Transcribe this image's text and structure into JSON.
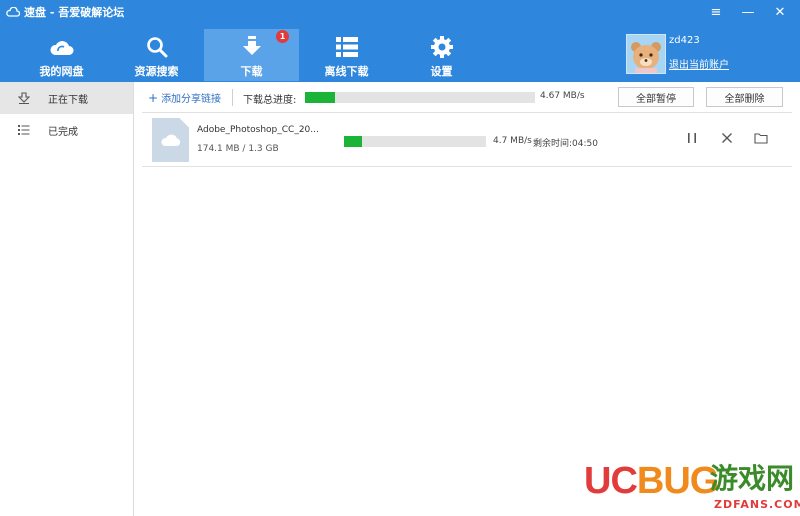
{
  "window": {
    "title": "速盘 - 吾爱破解论坛",
    "controls": [
      "≡",
      "—",
      "✕"
    ]
  },
  "nav": {
    "items": [
      {
        "label": "我的网盘",
        "icon": "cloud-icon"
      },
      {
        "label": "资源搜索",
        "icon": "search-icon"
      },
      {
        "label": "下载",
        "icon": "download-arrow-icon",
        "badge": "1",
        "active": true
      },
      {
        "label": "离线下载",
        "icon": "list-icon"
      },
      {
        "label": "设置",
        "icon": "gear-icon"
      }
    ]
  },
  "user": {
    "name": "zd423",
    "switch_account": "退出当前账户"
  },
  "sidebar": {
    "items": [
      {
        "label": "正在下载",
        "icon": "downloading-icon",
        "active": true
      },
      {
        "label": "已完成",
        "icon": "completed-list-icon"
      }
    ]
  },
  "toolbar": {
    "add_link": "添加分享链接",
    "total_progress_label": "下载总进度:",
    "total_progress_fraction": 0.13,
    "total_speed": "4.67 MB/s",
    "pause_all": "全部暂停",
    "delete_all": "全部删除"
  },
  "tasks": [
    {
      "file_name": "Adobe_Photoshop_CC_20...",
      "size": "174.1 MB / 1.3 GB",
      "progress_fraction": 0.13,
      "speed": "4.7 MB/s",
      "remaining": "剩余时间:04:50"
    }
  ],
  "watermark": {
    "brand": "UCBUG",
    "cn": "游戏网",
    "url": ".com",
    "url2": "ZDFANS.COM"
  },
  "colors": {
    "header": "#2e87dc",
    "progress": "#1bb437",
    "badge": "#e23b3b",
    "link": "#2e6fc2"
  }
}
